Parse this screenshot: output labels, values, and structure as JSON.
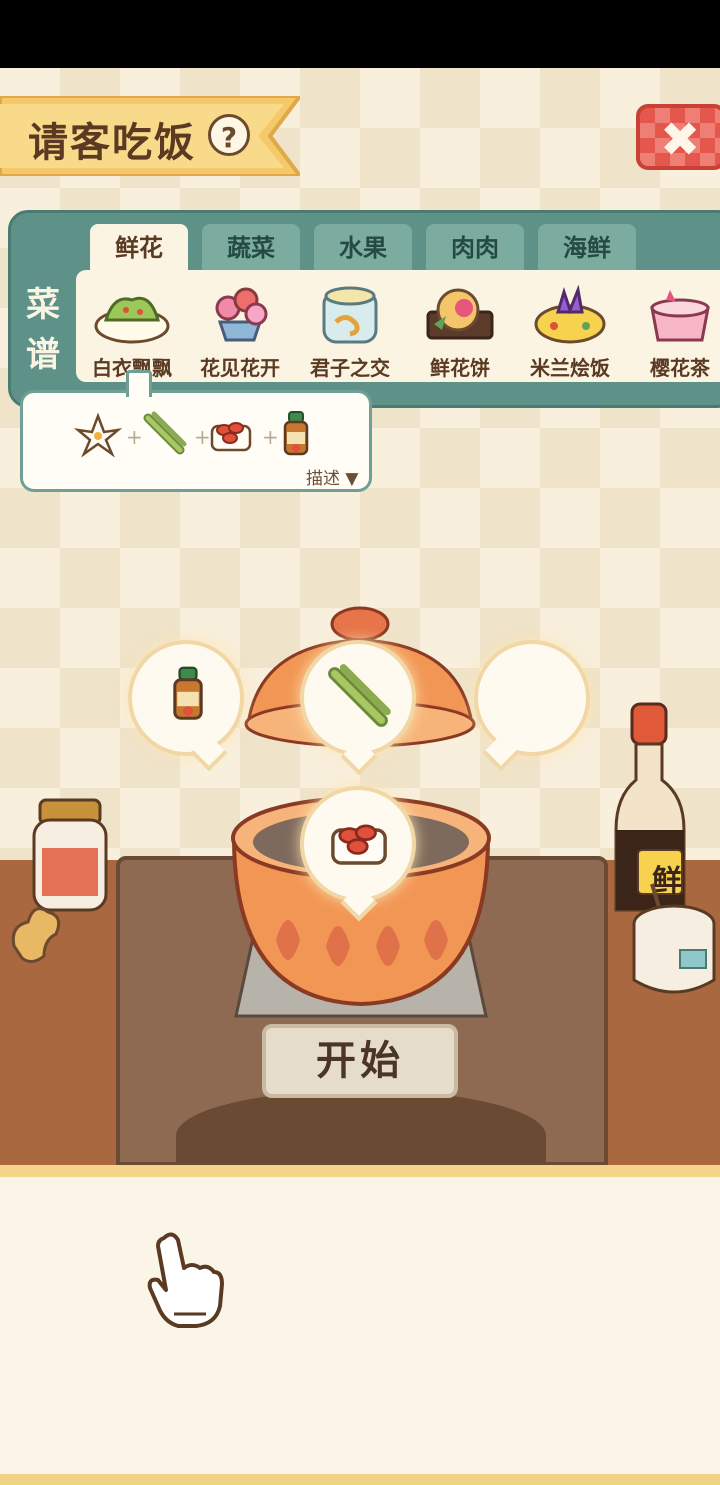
{
  "header": {
    "title": "请客吃饭",
    "help_label": "?"
  },
  "recipe_panel": {
    "side_label_line1": "菜",
    "side_label_line2": "谱",
    "tabs": [
      {
        "label": "鲜花",
        "active": true
      },
      {
        "label": "蔬菜",
        "active": false
      },
      {
        "label": "水果",
        "active": false
      },
      {
        "label": "肉肉",
        "active": false
      },
      {
        "label": "海鲜",
        "active": false
      }
    ],
    "dishes": [
      {
        "name": "白衣飘飘",
        "icon": "salad-dish-icon"
      },
      {
        "name": "花见花开",
        "icon": "flower-bowl-icon"
      },
      {
        "name": "君子之交",
        "icon": "jelly-dish-icon"
      },
      {
        "name": "鲜花饼",
        "icon": "flower-cake-icon"
      },
      {
        "name": "米兰烩饭",
        "icon": "risotto-icon"
      },
      {
        "name": "樱花茶",
        "icon": "sakura-tea-icon"
      }
    ]
  },
  "ingredients_popup": {
    "items": [
      "lily-icon",
      "asparagus-icon",
      "goji-icon",
      "sauce-bottle-icon"
    ],
    "plus": "+",
    "describe_label": "描述"
  },
  "cooking": {
    "slots": [
      "sauce-bottle-icon",
      "asparagus-icon",
      "empty-slot"
    ],
    "pot_slot": "goji-icon",
    "start_label": "开始",
    "bottle_label": "鲜"
  },
  "colors": {
    "panel": "#5e9288",
    "title_banner": "#f4c96a",
    "close": "#e3574c",
    "counter": "#a9683f"
  }
}
